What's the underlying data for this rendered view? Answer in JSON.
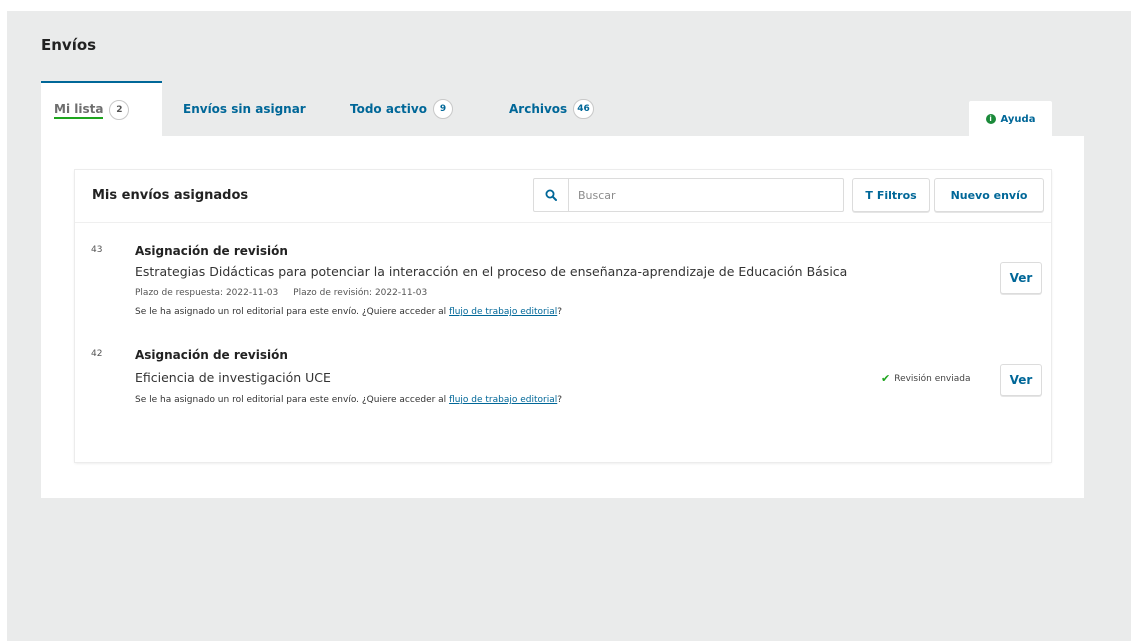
{
  "page": {
    "title": "Envíos"
  },
  "tabs": [
    {
      "label": "Mi lista",
      "count": "2"
    },
    {
      "label": "Envíos sin asignar"
    },
    {
      "label": "Todo activo",
      "count": "9"
    },
    {
      "label": "Archivos",
      "count": "46"
    }
  ],
  "help": {
    "label": "Ayuda",
    "icon": "info-icon"
  },
  "card": {
    "title": "Mis envíos asignados",
    "search_placeholder": "Buscar",
    "filters_label": "Filtros",
    "new_submission_label": "Nuevo envío"
  },
  "submissions": [
    {
      "id": "43",
      "type": "Asignación de revisión",
      "title": "Estrategias Didácticas para potenciar la interacción en el proceso de enseñanza-aprendizaje de Educación Básica",
      "response_deadline": "Plazo de respuesta: 2022-11-03",
      "review_deadline": "Plazo de revisión: 2022-11-03",
      "notice_prefix": "Se le ha asignado un rol editorial para este envío. ¿Quiere acceder al ",
      "notice_link": "flujo de trabajo editorial",
      "notice_suffix": "?",
      "view_label": "Ver"
    },
    {
      "id": "42",
      "type": "Asignación de revisión",
      "title": "Eficiencia de investigación UCE",
      "status": "Revisión enviada",
      "notice_prefix": "Se le ha asignado un rol editorial para este envío. ¿Quiere acceder al ",
      "notice_link": "flujo de trabajo editorial",
      "notice_suffix": "?",
      "view_label": "Ver"
    }
  ],
  "colors": {
    "link": "#006798",
    "accent_green": "#1ea51e",
    "background": "#eaebeb"
  }
}
